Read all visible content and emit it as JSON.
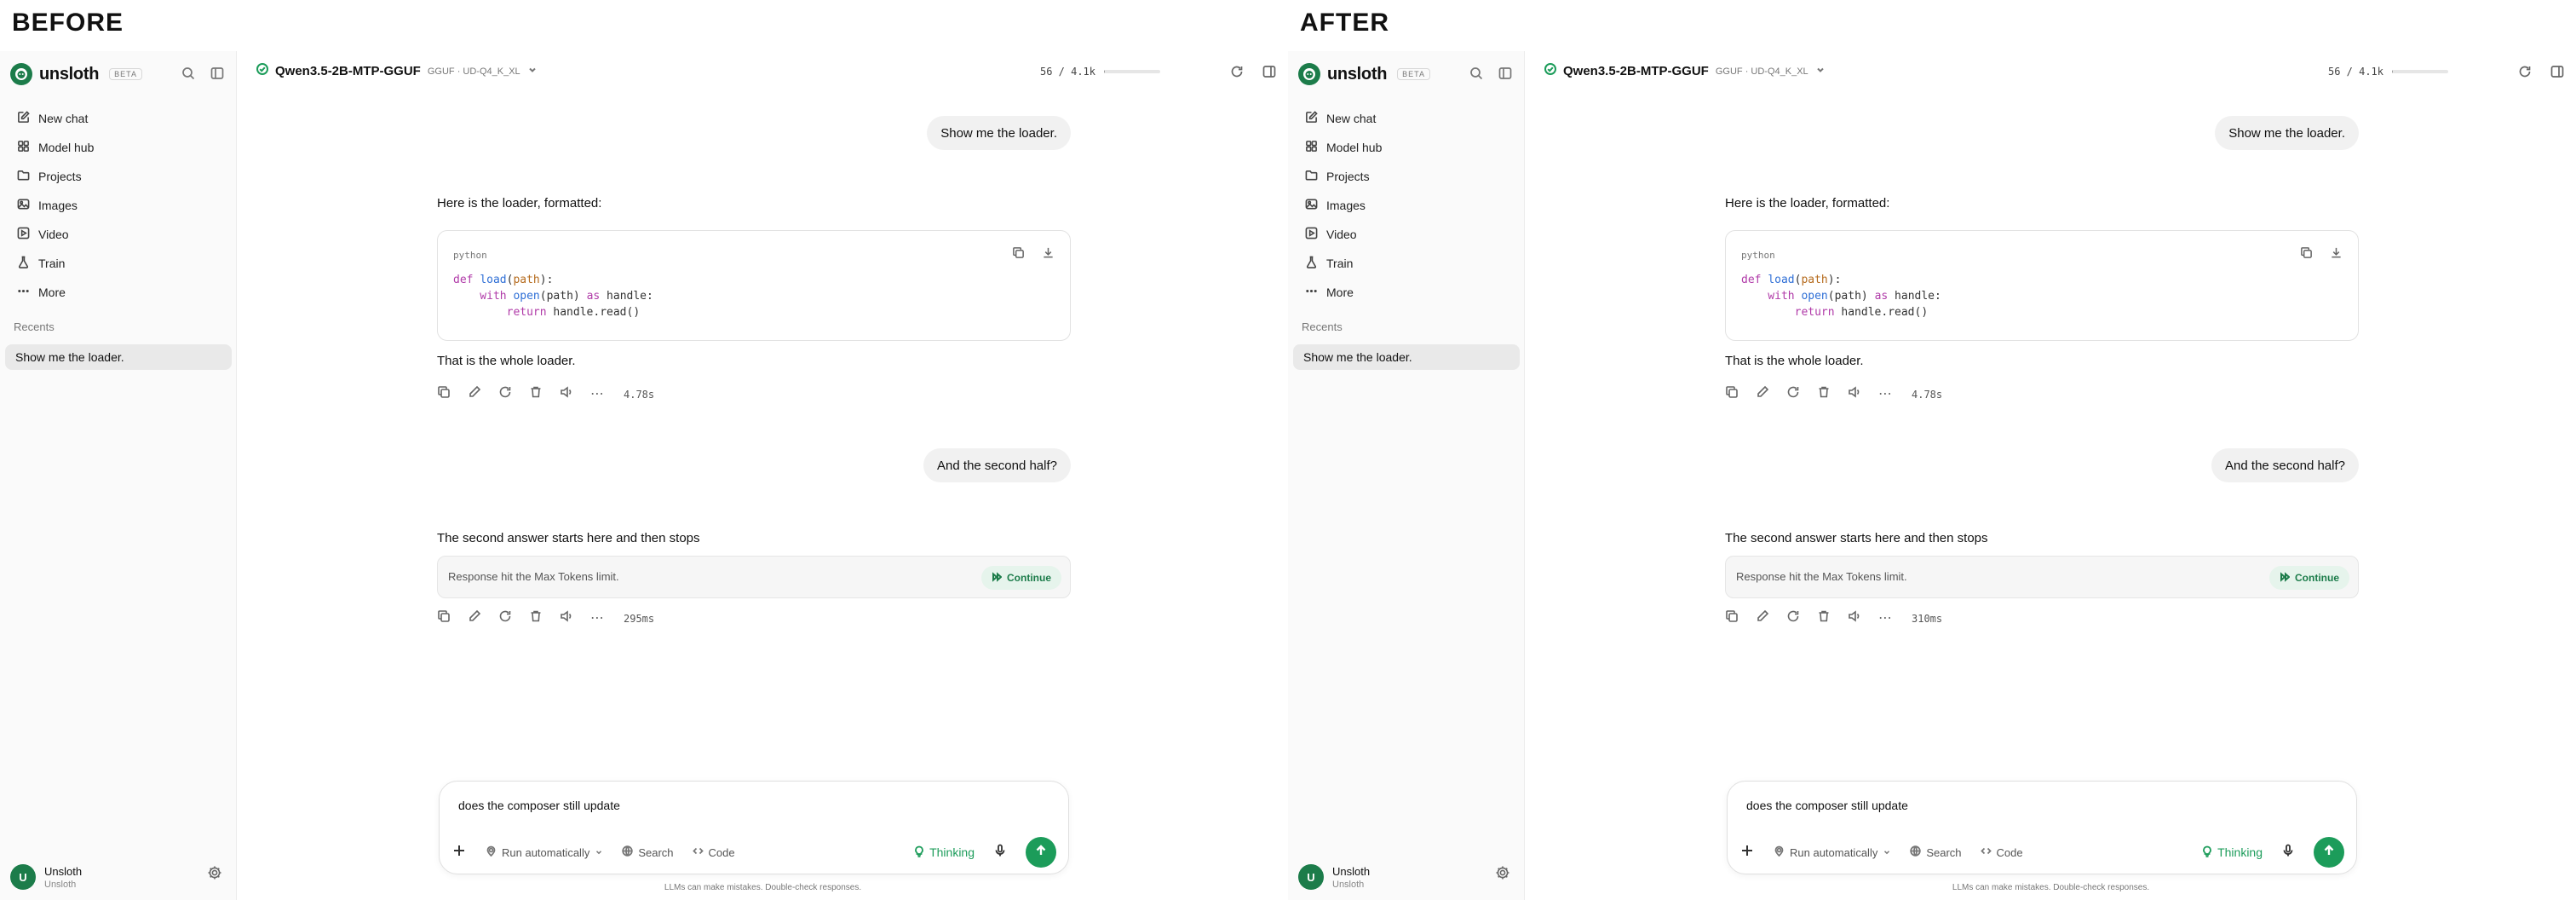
{
  "panels": [
    {
      "label": "BEFORE",
      "sidebar": {
        "brand": "unsloth",
        "beta": "BETA",
        "nav": [
          "New chat",
          "Model hub",
          "Projects",
          "Images",
          "Video",
          "Train",
          "More"
        ],
        "recents_label": "Recents",
        "recent_item": "Show me the loader.",
        "user_name": "Unsloth",
        "user_sub": "Unsloth",
        "avatar_letter": "U"
      },
      "topbar": {
        "model_name": "Qwen3.5-2B-MTP-GGUF",
        "model_quant": "GGUF · UD-Q4_K_XL",
        "context": "56 / 4.1k",
        "context_fraction": 0.014
      },
      "chat": {
        "msg1": "Show me the loader.",
        "reply1_intro": "Here is the loader, formatted:",
        "code_lang": "python",
        "reply1_outro": "That is the whole loader.",
        "time1": "4.78s",
        "msg2": "And the second half?",
        "reply2": "The second answer starts here and then stops",
        "limit_text": "Response hit the Max Tokens limit.",
        "continue_label": "Continue",
        "time2": "295ms"
      },
      "composer": {
        "value": "does the composer still update",
        "run": "Run automatically",
        "search": "Search",
        "code": "Code",
        "thinking": "Thinking",
        "disclaimer": "LLMs can make mistakes. Double-check responses."
      }
    },
    {
      "label": "AFTER",
      "sidebar": {
        "brand": "unsloth",
        "beta": "BETA",
        "nav": [
          "New chat",
          "Model hub",
          "Projects",
          "Images",
          "Video",
          "Train",
          "More"
        ],
        "recents_label": "Recents",
        "recent_item": "Show me the loader.",
        "user_name": "Unsloth",
        "user_sub": "Unsloth",
        "avatar_letter": "U"
      },
      "topbar": {
        "model_name": "Qwen3.5-2B-MTP-GGUF",
        "model_quant": "GGUF · UD-Q4_K_XL",
        "context": "56 / 4.1k",
        "context_fraction": 0.014
      },
      "chat": {
        "msg1": "Show me the loader.",
        "reply1_intro": "Here is the loader, formatted:",
        "code_lang": "python",
        "reply1_outro": "That is the whole loader.",
        "time1": "4.78s",
        "msg2": "And the second half?",
        "reply2": "The second answer starts here and then stops",
        "limit_text": "Response hit the Max Tokens limit.",
        "continue_label": "Continue",
        "time2": "310ms"
      },
      "composer": {
        "value": "does the composer still update",
        "run": "Run automatically",
        "search": "Search",
        "code": "Code",
        "thinking": "Thinking",
        "disclaimer": "LLMs can make mistakes. Double-check responses."
      }
    }
  ],
  "code": {
    "line1": [
      "def ",
      "load",
      "(",
      "path",
      "):"
    ],
    "line2": [
      "    with ",
      "open",
      "(path) ",
      "as",
      " handle:"
    ],
    "line3": [
      "        return",
      " handle.read()"
    ]
  },
  "icons": {
    "nav": [
      "pencil-square-icon",
      "grid-icon",
      "folder-icon",
      "image-icon",
      "video-icon",
      "flask-icon",
      "ellipsis-icon"
    ]
  },
  "colors": {
    "accent": "#1c9c5a",
    "brand": "#1c7c4a"
  }
}
